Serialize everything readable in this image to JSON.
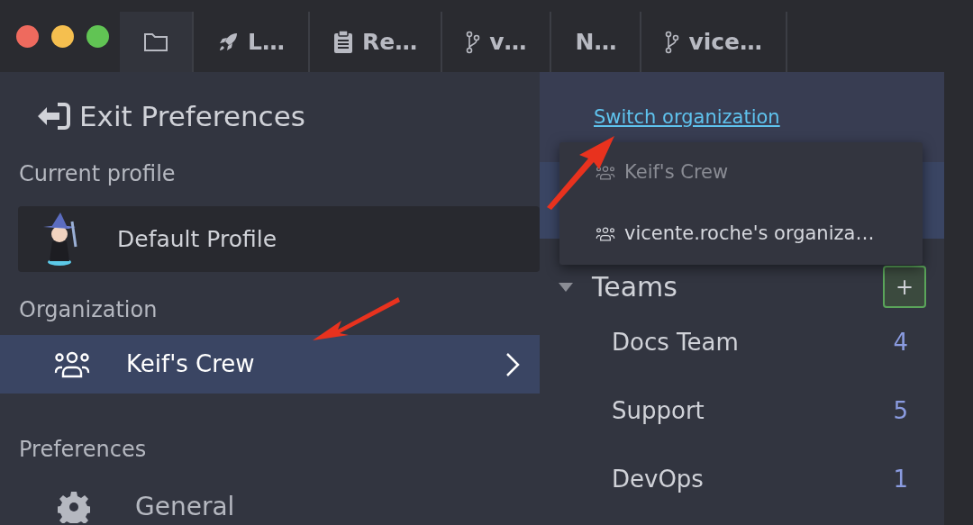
{
  "tabs": [
    {
      "kind": "folder",
      "selected": true
    },
    {
      "kind": "rocket",
      "label": "L…",
      "selected": false
    },
    {
      "kind": "clipboard",
      "label": "Re…",
      "selected": false
    },
    {
      "kind": "branch",
      "label": "v…",
      "selected": false
    },
    {
      "kind": "plain",
      "label": "N…",
      "selected": false
    },
    {
      "kind": "branch",
      "label": "vice…",
      "selected": false
    }
  ],
  "sidebar": {
    "exit_label": "Exit Preferences",
    "profile_heading": "Current profile",
    "profile": "Default Profile",
    "organization_heading": "Organization",
    "organization": {
      "name": "Keif's Crew",
      "selected": true
    },
    "preferences_heading": "Preferences",
    "items": [
      {
        "label": "General",
        "kind": "gear"
      }
    ]
  },
  "panel": {
    "switch_link": "Switch organization",
    "org_menu": [
      {
        "name": "Keif's Crew",
        "disabled": true
      },
      {
        "name": "vicente.roche's organiza…",
        "disabled": false
      }
    ],
    "teams": {
      "title": "Teams",
      "expanded": true,
      "add_button": "+",
      "rows": [
        {
          "name": "Docs Team",
          "count": "4"
        },
        {
          "name": "Support",
          "count": "5"
        },
        {
          "name": "DevOps",
          "count": "1"
        }
      ]
    }
  }
}
